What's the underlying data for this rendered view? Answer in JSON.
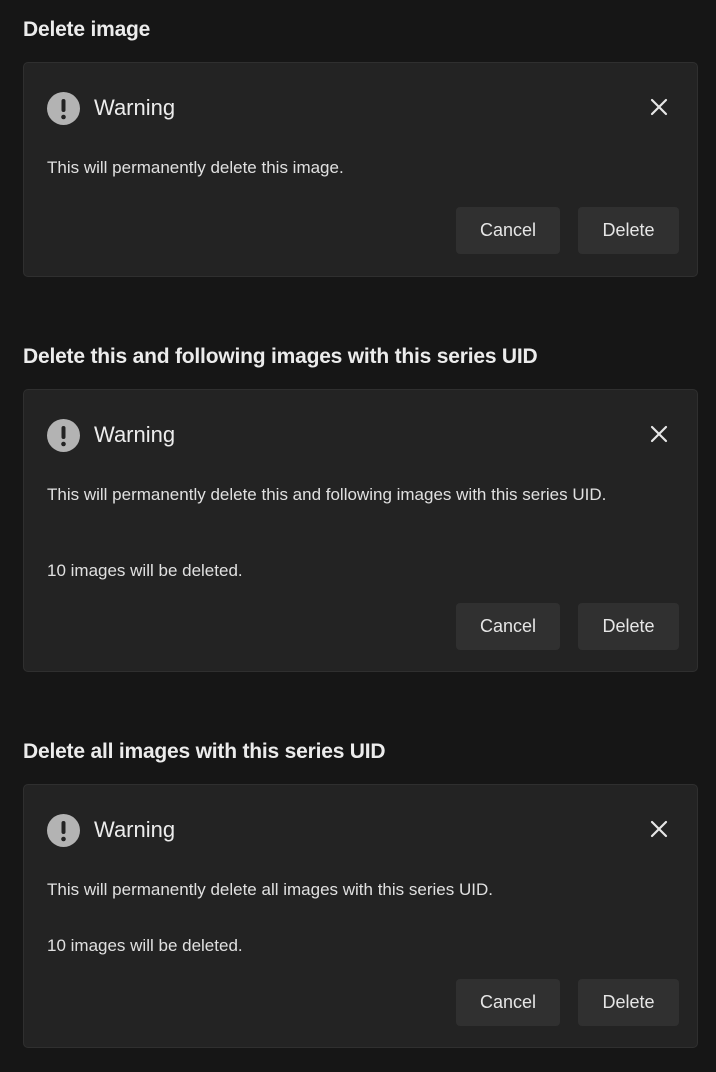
{
  "sections": [
    {
      "heading": "Delete image",
      "dialog": {
        "title": "Warning",
        "message": "This will permanently delete this image.",
        "count_text": "",
        "cancel_label": "Cancel",
        "delete_label": "Delete"
      }
    },
    {
      "heading": "Delete this and following images with this series UID",
      "dialog": {
        "title": "Warning",
        "message": "This will permanently delete this and following images with this series UID.",
        "count_text": "10 images will be deleted.",
        "cancel_label": "Cancel",
        "delete_label": "Delete"
      }
    },
    {
      "heading": "Delete all images with this series UID",
      "dialog": {
        "title": "Warning",
        "message": "This will permanently delete all images with this series UID.",
        "count_text": "10 images will be deleted.",
        "cancel_label": "Cancel",
        "delete_label": "Delete"
      }
    }
  ],
  "icons": {
    "warning": "exclamation-circle-icon",
    "close": "close-icon"
  },
  "colors": {
    "background": "#161616",
    "dialog": "#232323",
    "button": "#303030",
    "icon": "#b3b3b3"
  }
}
